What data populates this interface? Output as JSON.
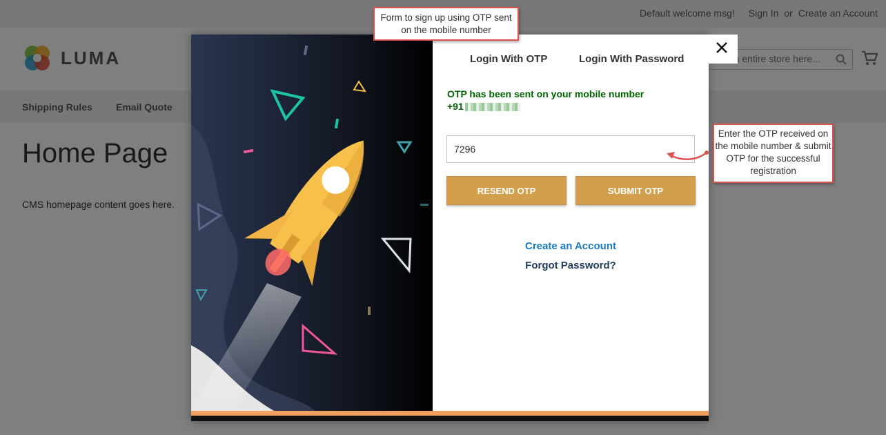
{
  "topbar": {
    "welcome": "Default welcome msg!",
    "sign_in": "Sign In",
    "or": "or",
    "create_account": "Create an Account"
  },
  "header": {
    "logo_text": "LUMA",
    "search_placeholder": "Search entire store here..."
  },
  "nav": {
    "items": [
      "Shipping Rules",
      "Email Quote"
    ]
  },
  "page": {
    "title": "Home Page",
    "content": "CMS homepage content goes here."
  },
  "modal": {
    "tabs": [
      "Login With OTP",
      "Login With Password"
    ],
    "message": "OTP has been sent on your mobile number",
    "phone_prefix": "+91",
    "otp_value": "7296",
    "resend_label": "RESEND OTP",
    "submit_label": "SUBMIT OTP",
    "create_account_link": "Create an Account",
    "forgot_password_link": "Forgot Password?"
  },
  "callouts": {
    "top": "Form to sign up using OTP sent on the mobile number",
    "right": "Enter the OTP received on the mobile number & submit OTP for the successful registration"
  },
  "colors": {
    "button": "#d2a04c",
    "success_text": "#006400",
    "link": "#1979c3",
    "callout_border": "#d9534f"
  }
}
